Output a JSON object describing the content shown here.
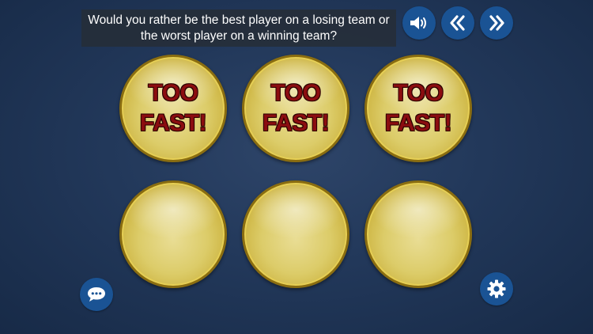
{
  "question": {
    "line1": "Would you rather be the best player on a losing team or",
    "line2": "the worst player on a winning team?"
  },
  "controls": {
    "sound_icon": "speaker-volume-icon",
    "back_icon": "double-chevron-left-icon",
    "forward_icon": "double-chevron-right-icon",
    "chat_icon": "chat-bubble-icon",
    "settings_icon": "gear-icon"
  },
  "balls": [
    {
      "line1": "TOO",
      "line2": "FAST!"
    },
    {
      "line1": "TOO",
      "line2": "FAST!"
    },
    {
      "line1": "TOO",
      "line2": "FAST!"
    },
    {
      "line1": "",
      "line2": ""
    },
    {
      "line1": "",
      "line2": ""
    },
    {
      "line1": "",
      "line2": ""
    }
  ],
  "colors": {
    "button_blue": "#1a5394",
    "ball_gold": "#dccc69",
    "ball_text": "#8b0d10",
    "background": "#22385a"
  }
}
